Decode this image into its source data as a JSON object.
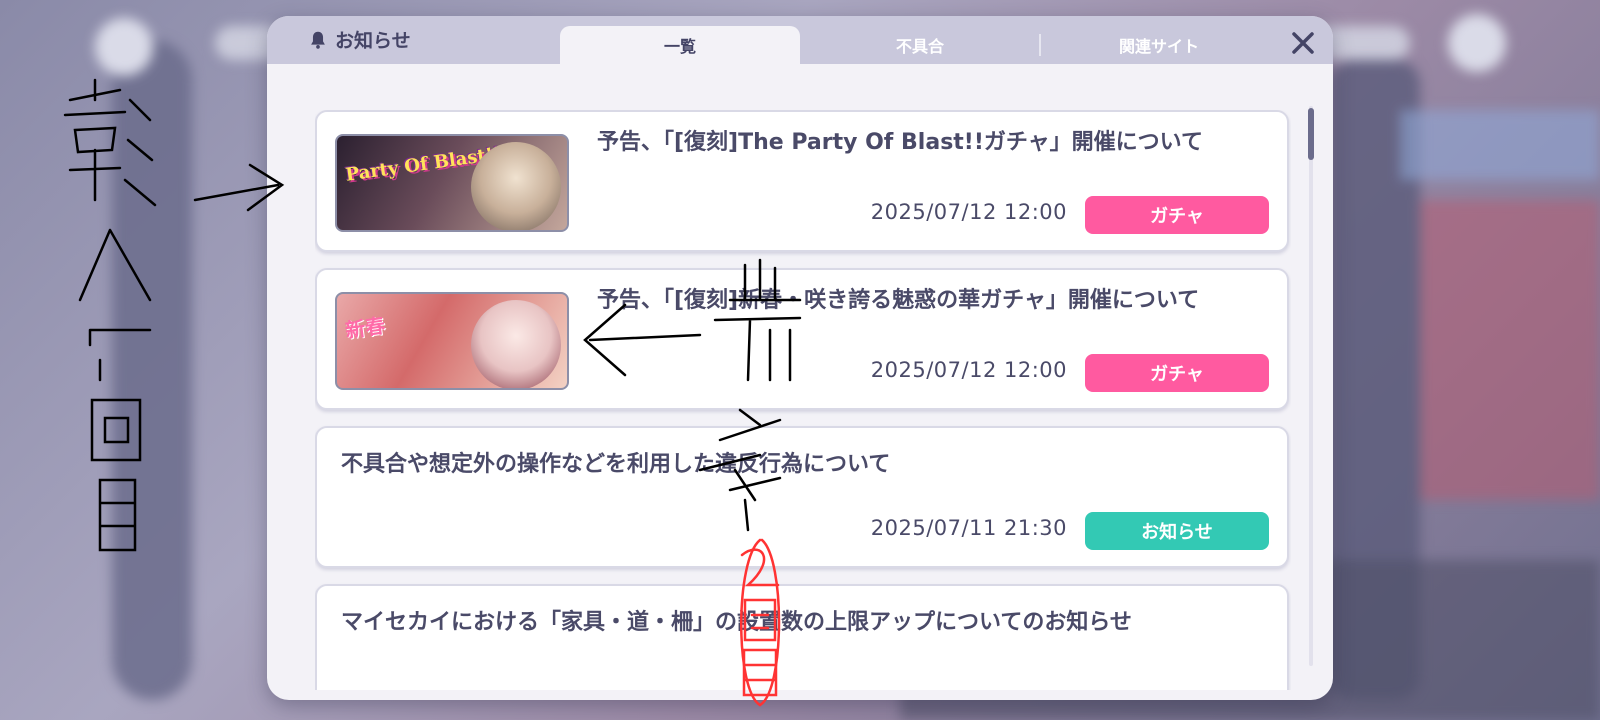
{
  "header": {
    "title": "お知らせ",
    "tabs": [
      {
        "label": "一覧",
        "active": true
      },
      {
        "label": "不具合",
        "active": false
      },
      {
        "label": "関連サイト",
        "active": false
      }
    ]
  },
  "notices": [
    {
      "title": "予告、「[復刻]The Party Of Blast!!ガチャ」開催について",
      "date": "2025/07/12 12:00",
      "badge": "ガチャ",
      "badge_color": "#ff5aa0",
      "thumb_text": "Party Of Blast!!"
    },
    {
      "title": "予告、「[復刻]新春・咲き誇る魅惑の華ガチャ」開催について",
      "date": "2025/07/12 12:00",
      "badge": "ガチャ",
      "badge_color": "#ff5aa0",
      "thumb_text": "新春"
    },
    {
      "title": "不具合や想定外の操作などを利用した違反行為について",
      "date": "2025/07/11 21:30",
      "badge": "お知らせ",
      "badge_color": "#33c9b4"
    },
    {
      "title": "マイセカイにおける「家具・道・柵」の設置数の上限アップについてのお知らせ"
    }
  ],
  "colors": {
    "accent_pink": "#ff5aa0",
    "accent_teal": "#33c9b4",
    "text": "#4a4a68",
    "header_bg": "#c9c8dc"
  }
}
